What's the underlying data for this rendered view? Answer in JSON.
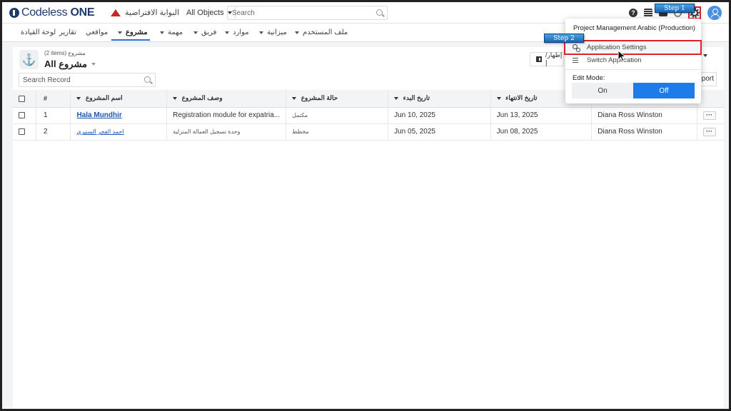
{
  "header": {
    "logo_text": "Codeless",
    "logo_bold": "ONE",
    "portal_label": "البوابة الافتراضية",
    "object_select": "All Objects",
    "search_placeholder": "Search"
  },
  "nav": {
    "items": [
      {
        "label": "لوحة القيادة",
        "has_caret": false
      },
      {
        "label": "تقارير",
        "has_caret": false
      },
      {
        "label": "مواقعي",
        "has_caret": false
      },
      {
        "label": "مشروع",
        "has_caret": true,
        "active": true
      },
      {
        "label": "مهمة",
        "has_caret": true
      },
      {
        "label": "فريق",
        "has_caret": true
      },
      {
        "label": "موارد",
        "has_caret": true
      },
      {
        "label": "ميزانية",
        "has_caret": true
      },
      {
        "label": "ملف المستخدم",
        "has_caret": true
      }
    ]
  },
  "view": {
    "count": "(2 items) مشروع",
    "title": "All مشروع",
    "search_placeholder": "Search Record",
    "showhide_label": "إظهار/إ",
    "report_label": "Report"
  },
  "table": {
    "columns": [
      "#",
      "اسم المشروع",
      "وصف المشروع",
      "حالة المشروع",
      "تاريخ البدء",
      "تاريخ الانتهاء",
      ""
    ],
    "rows": [
      {
        "num": "1",
        "name": "Hala Mundhir",
        "desc": "Registration module for expatria...",
        "status": "مكتمل",
        "start": "Jun 10, 2025",
        "end": "Jun 13, 2025",
        "owner": "Diana Ross Winston"
      },
      {
        "num": "2",
        "name": "احمد الفجر السنيري",
        "desc": "وحدة تسجيل العمالة المنزلية",
        "status": "مخطط",
        "start": "Jun 05, 2025",
        "end": "Jun 08, 2025",
        "owner": "Diana Ross Winston"
      }
    ]
  },
  "menu": {
    "app_name": "Project Management Arabic (Production)",
    "app_settings": "Application Settings",
    "switch_app": "Switch Application",
    "edit_mode_label": "Edit Mode:",
    "on_label": "On",
    "off_label": "Off"
  },
  "callouts": {
    "step1": "Step 1",
    "step2": "Step 2"
  },
  "colors": {
    "accent": "#1e7bea",
    "highlight": "#e0202a",
    "link": "#1a56b8"
  }
}
